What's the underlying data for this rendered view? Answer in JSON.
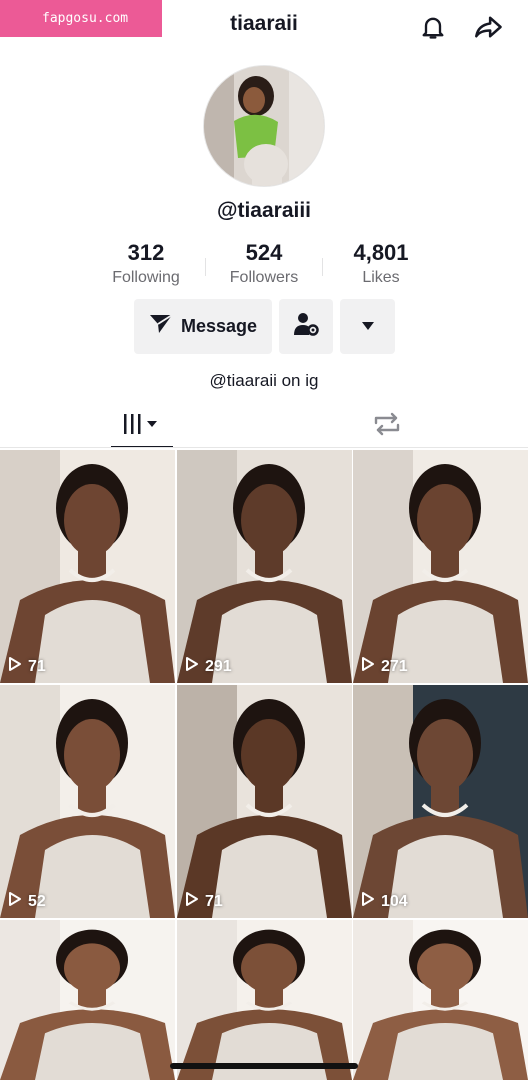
{
  "watermark": "fapgosu.com",
  "header": {
    "title": "tiaaraii"
  },
  "icons": {
    "bell": "bell-icon",
    "share": "share-arrow-icon",
    "message": "paper-plane-icon",
    "add_friend": "person-gear-icon",
    "more": "caret-down-icon",
    "videos_tab": "grid-bars-icon",
    "reposts_tab": "repost-icon",
    "play": "play-icon"
  },
  "profile": {
    "username": "@tiaaraiii",
    "stats": {
      "following": {
        "value": "312",
        "label": "Following"
      },
      "followers": {
        "value": "524",
        "label": "Followers"
      },
      "likes": {
        "value": "4,801",
        "label": "Likes"
      }
    },
    "message_button": "Message",
    "bio": "@tiaaraii on ig"
  },
  "colors": {
    "text": "#161823",
    "muted": "#6b6b70",
    "button_bg": "#f1f1f2",
    "watermark_bg": "#ec5a96"
  },
  "videos": [
    {
      "views": "71"
    },
    {
      "views": "291"
    },
    {
      "views": "271"
    },
    {
      "views": "52"
    },
    {
      "views": "71"
    },
    {
      "views": "104"
    },
    {
      "views": ""
    },
    {
      "views": ""
    },
    {
      "views": ""
    }
  ]
}
